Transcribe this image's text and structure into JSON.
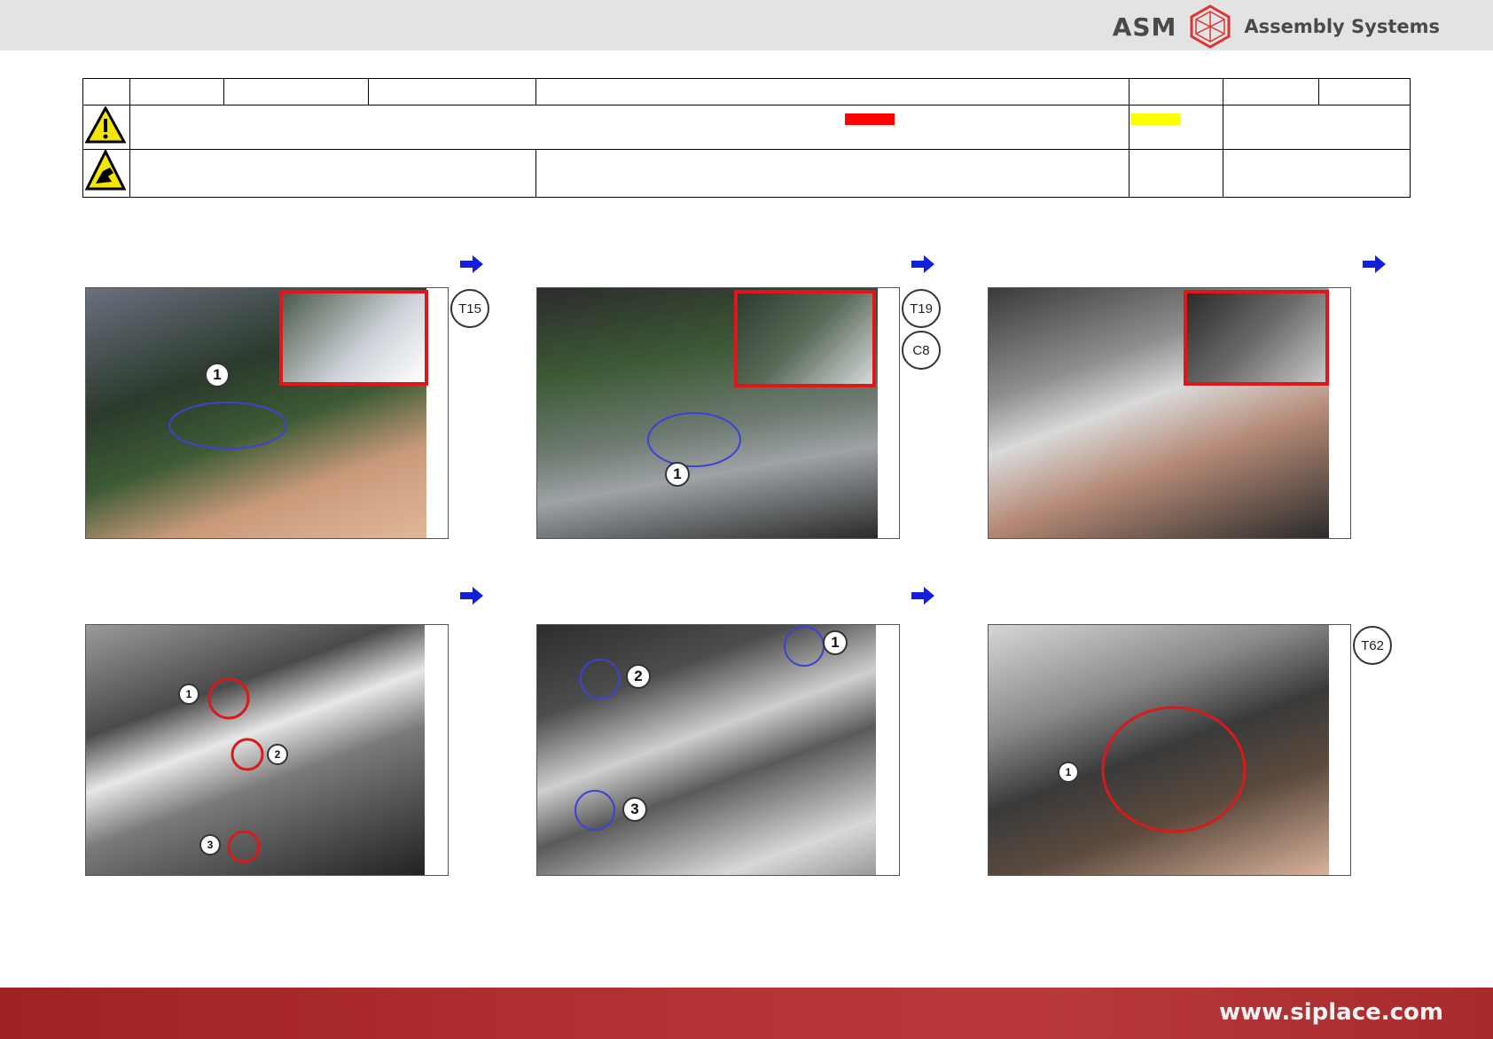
{
  "brand": {
    "logo_text": "ASM",
    "company": "Assembly Systems"
  },
  "header_table": {
    "warning_icon": "warning-triangle-icon",
    "esd_icon": "esd-hand-icon",
    "colors": {
      "red_marker": "#ff0000",
      "yellow_marker": "#ffff00"
    }
  },
  "arrow_icon": "blue-arrow-right-icon",
  "steps": [
    {
      "badges": [
        "T15"
      ],
      "callouts": [
        "1"
      ]
    },
    {
      "badges": [
        "T19",
        "C8"
      ],
      "callouts": [
        "1"
      ]
    },
    {
      "badges": [],
      "callouts": []
    },
    {
      "badges": [],
      "callouts": [
        "1",
        "2",
        "3"
      ]
    },
    {
      "badges": [],
      "callouts": [
        "1",
        "2",
        "3"
      ]
    },
    {
      "badges": [
        "T62"
      ],
      "callouts": [
        "1"
      ]
    }
  ],
  "footer": {
    "url": "www.siplace.com"
  }
}
